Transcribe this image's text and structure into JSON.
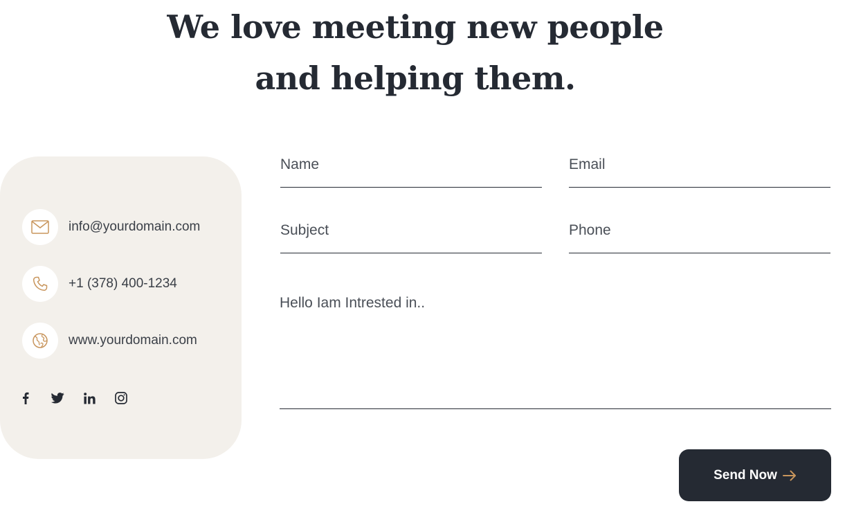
{
  "heading": {
    "line1": "We love meeting new people",
    "line2": "and helping them."
  },
  "contact_info": {
    "email": "info@yourdomain.com",
    "phone": "+1 (378) 400-1234",
    "website": "www.yourdomain.com",
    "icons": [
      "mail-icon",
      "phone-icon",
      "globe-icon"
    ],
    "social": [
      "facebook-icon",
      "twitter-icon",
      "linkedin-icon",
      "instagram-icon"
    ]
  },
  "form": {
    "name_placeholder": "Name",
    "email_placeholder": "Email",
    "subject_placeholder": "Subject",
    "phone_placeholder": "Phone",
    "message_placeholder": "Hello Iam Intrested in..",
    "submit_label": "Send Now"
  },
  "colors": {
    "dark": "#252a33",
    "accent": "#c8955c",
    "card_bg": "#f3f0eb"
  }
}
